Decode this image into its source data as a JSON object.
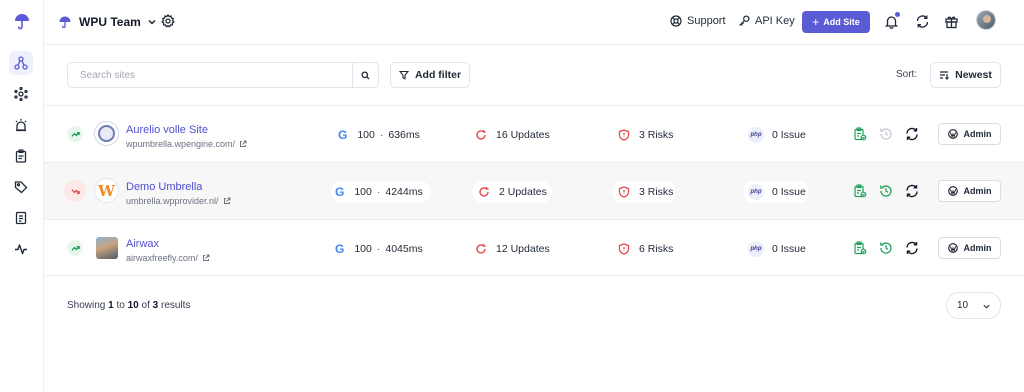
{
  "app": {
    "team_name": "WPU Team"
  },
  "header": {
    "support_label": "Support",
    "api_key_label": "API Key",
    "add_site_label": "Add Site"
  },
  "rail": {
    "items": [
      "sites-icon",
      "nodes-icon",
      "alert-icon",
      "reports-icon",
      "tags-icon",
      "invoice-icon",
      "activity-icon"
    ]
  },
  "toolbar": {
    "search_placeholder": "Search sites",
    "filter_label": "Add filter",
    "sort_label": "Sort:",
    "sort_value": "Newest"
  },
  "sites": [
    {
      "name": "Aurelio volle Site",
      "url": "wpumbrella.wpengine.com/",
      "trend": "up",
      "score": "100",
      "response": "636ms",
      "updates": "16 Updates",
      "risks": "3 Risks",
      "php": "php",
      "issues": "0 Issue",
      "admin_label": "Admin"
    },
    {
      "name": "Demo Umbrella",
      "url": "umbrella.wpprovider.nl/",
      "trend": "down",
      "score": "100",
      "response": "4244ms",
      "updates": "2 Updates",
      "risks": "3 Risks",
      "php": "php",
      "issues": "0 Issue",
      "admin_label": "Admin",
      "logo_letter": "W"
    },
    {
      "name": "Airwax",
      "url": "airwaxfreefly.com/",
      "trend": "up",
      "score": "100",
      "response": "4045ms",
      "updates": "12 Updates",
      "risks": "6 Risks",
      "php": "php",
      "issues": "0 Issue",
      "admin_label": "Admin"
    }
  ],
  "pagination": {
    "showing_prefix": "Showing",
    "from": "1",
    "to_word": "to",
    "to": "10",
    "of_word": "of",
    "total": "3",
    "results_word": "results",
    "per_page": "10"
  },
  "colors": {
    "accent": "#5b5bd6",
    "success": "#22a05a",
    "danger": "#e5484d",
    "link": "#4f4fd0"
  },
  "glyphs": {
    "google": "G",
    "separator": "·",
    "plus": "+"
  }
}
